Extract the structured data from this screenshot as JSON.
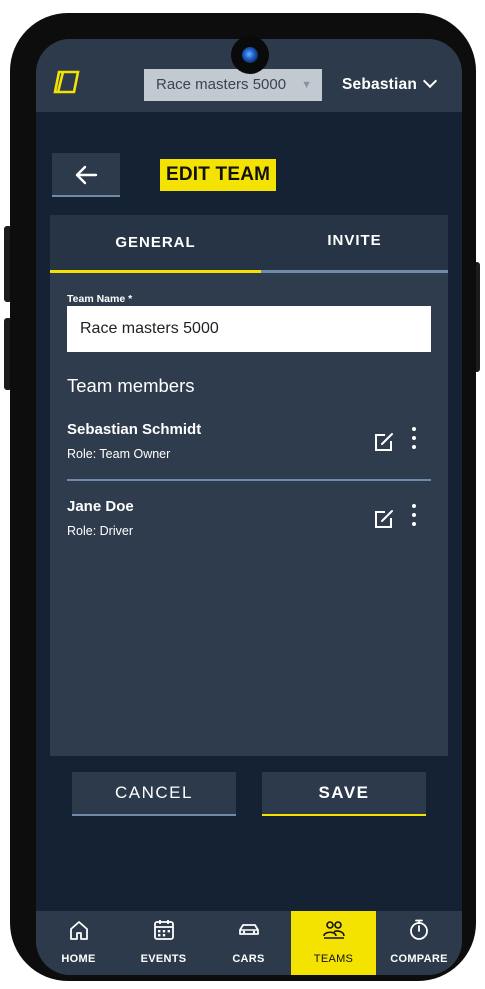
{
  "topbar": {
    "logo_icon": "app-logo-icon",
    "team_select": {
      "value": "Race masters 5000"
    },
    "user_menu": {
      "label": "Sebastian"
    }
  },
  "header": {
    "title": "EDIT TEAM"
  },
  "tabs": [
    {
      "label": "GENERAL",
      "active": true
    },
    {
      "label": "INVITE",
      "active": false
    }
  ],
  "form": {
    "team_name_label": "Team Name *",
    "team_name_value": "Race masters 5000",
    "members_title": "Team members",
    "members": [
      {
        "name": "Sebastian Schmidt",
        "role": "Role: Team Owner"
      },
      {
        "name": "Jane Doe",
        "role": "Role: Driver"
      }
    ]
  },
  "actions": {
    "cancel_label": "CANCEL",
    "save_label": "SAVE"
  },
  "bottom_nav": [
    {
      "label": "HOME",
      "icon": "home-icon",
      "active": false
    },
    {
      "label": "EVENTS",
      "icon": "calendar-icon",
      "active": false
    },
    {
      "label": "CARS",
      "icon": "car-icon",
      "active": false
    },
    {
      "label": "TEAMS",
      "icon": "users-icon",
      "active": true
    },
    {
      "label": "COMPARE",
      "icon": "stopwatch-icon",
      "active": false
    }
  ],
  "colors": {
    "accent": "#f4e200",
    "background": "#152233",
    "surface": "#2f3c4d",
    "bar": "#2d3a4b",
    "divider": "#6f8aab"
  }
}
